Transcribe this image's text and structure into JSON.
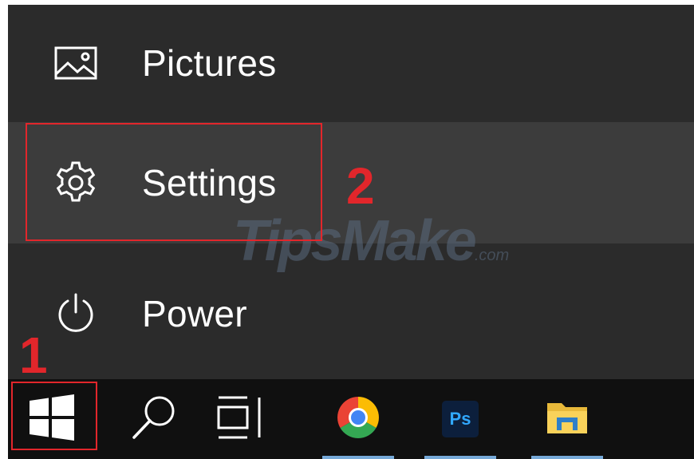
{
  "start_menu": {
    "items": [
      {
        "label": "Pictures",
        "icon": "pictures-icon"
      },
      {
        "label": "Settings",
        "icon": "gear-icon"
      },
      {
        "label": "Power",
        "icon": "power-icon"
      }
    ]
  },
  "annotations": {
    "step_1": "1",
    "step_2": "2",
    "highlight_color": "#e2262b"
  },
  "watermark": {
    "text": "TipsMake",
    "suffix": ".com"
  },
  "taskbar": {
    "buttons": [
      {
        "name": "start",
        "icon": "windows-logo-icon"
      },
      {
        "name": "search",
        "icon": "search-icon"
      },
      {
        "name": "task-view",
        "icon": "task-view-icon"
      },
      {
        "name": "chrome",
        "icon": "chrome-icon"
      },
      {
        "name": "photoshop",
        "icon": "photoshop-icon",
        "label": "Ps"
      },
      {
        "name": "file-explorer",
        "icon": "folder-icon"
      }
    ]
  },
  "colors": {
    "menu_background": "#2b2b2b",
    "menu_hover": "#3c3c3c",
    "taskbar_background": "#101010",
    "active_indicator": "#76a9d8"
  }
}
